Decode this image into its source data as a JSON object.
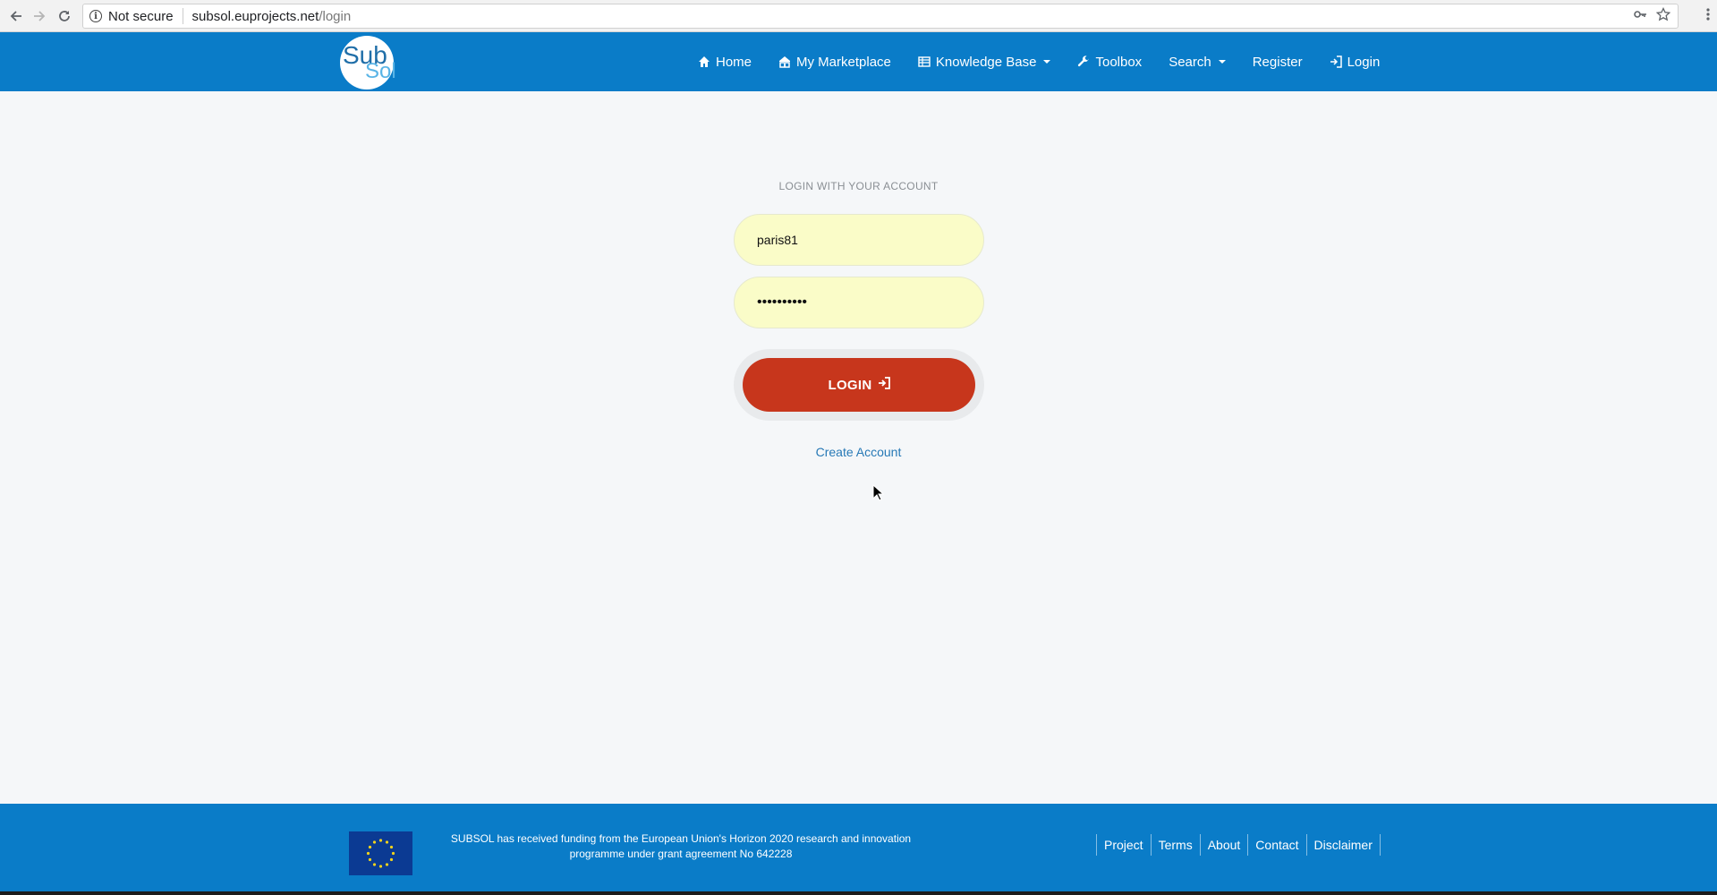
{
  "browser": {
    "security_label": "Not secure",
    "url_host": "subsol.euprojects.net",
    "url_path": "/login"
  },
  "header": {
    "logo": {
      "line1": "Sub",
      "line2": "Sol"
    },
    "nav": [
      {
        "label": "Home",
        "icon": "home-icon"
      },
      {
        "label": "My Marketplace",
        "icon": "marketplace-icon"
      },
      {
        "label": "Knowledge Base",
        "icon": "table-icon",
        "dropdown": true
      },
      {
        "label": "Toolbox",
        "icon": "wrench-icon"
      },
      {
        "label": "Search",
        "dropdown": true
      },
      {
        "label": "Register"
      },
      {
        "label": "Login",
        "icon": "sign-in-icon"
      }
    ]
  },
  "login": {
    "title": "LOGIN WITH YOUR ACCOUNT",
    "username_value": "paris81",
    "password_value": "••••••••••",
    "button_label": "LOGIN",
    "create_account": "Create Account"
  },
  "footer": {
    "funding_text": "SUBSOL has received funding from the European Union's Horizon 2020 research and innovation programme under grant agreement No 642228",
    "links": [
      "Project",
      "Terms",
      "About",
      "Contact",
      "Disclaimer"
    ]
  },
  "colors": {
    "brand_blue": "#0a7cc8",
    "login_red": "#c7361c",
    "field_yellow": "#fafcc8",
    "link_blue": "#2779b6"
  }
}
